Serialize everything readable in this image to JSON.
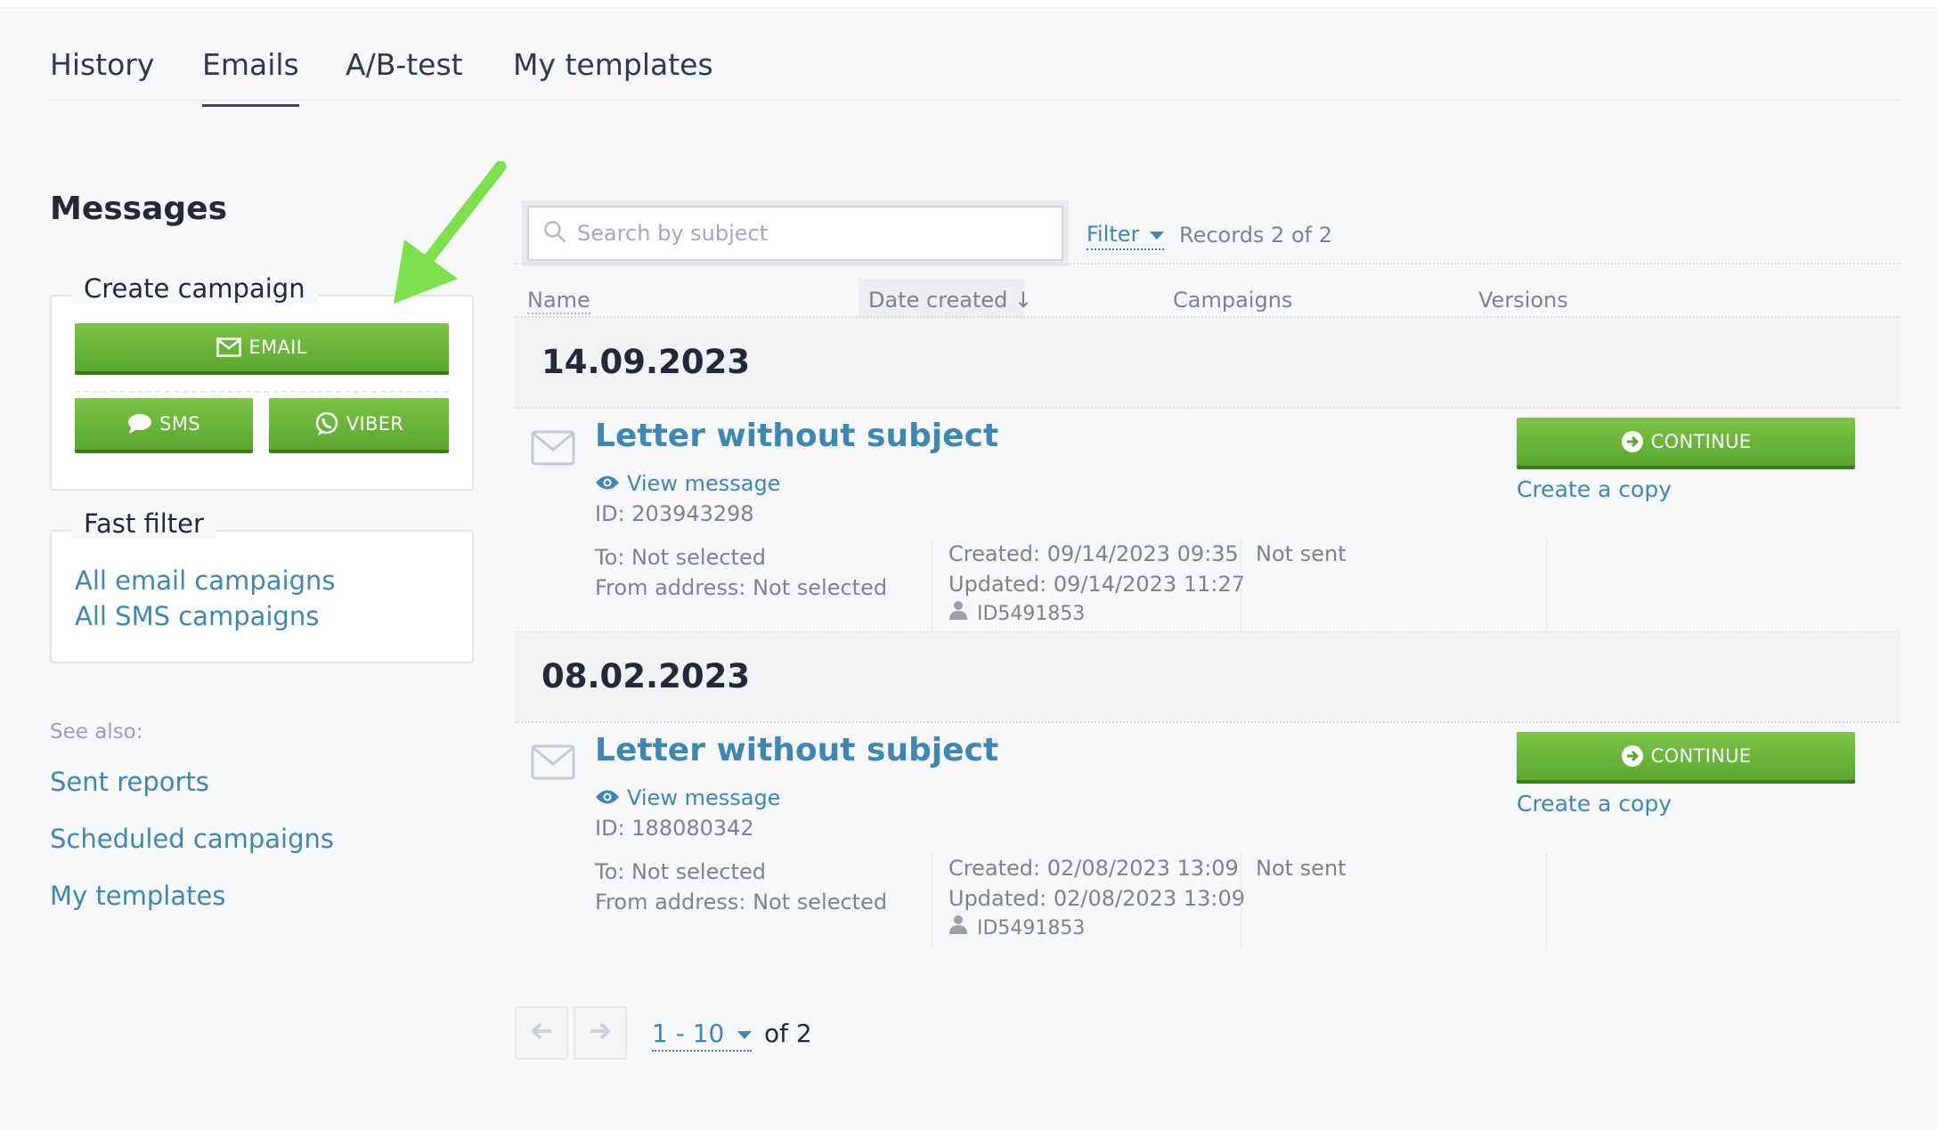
{
  "tabs": [
    {
      "label": "History"
    },
    {
      "label": "Emails"
    },
    {
      "label": "A/B-test"
    },
    {
      "label": "My templates"
    }
  ],
  "sidebar": {
    "title": "Messages",
    "create_campaign": {
      "legend": "Create campaign",
      "email_label": "EMAIL",
      "sms_label": "SMS",
      "viber_label": "VIBER"
    },
    "fast_filter": {
      "legend": "Fast filter",
      "items": [
        {
          "label": "All email campaigns"
        },
        {
          "label": "All SMS campaigns"
        }
      ]
    },
    "see_also": {
      "label": "See also:",
      "links": [
        {
          "label": "Sent reports"
        },
        {
          "label": "Scheduled campaigns"
        },
        {
          "label": "My templates"
        }
      ]
    }
  },
  "toolbar": {
    "search_placeholder": "Search by subject",
    "filter_label": "Filter",
    "records": "Records 2 of 2"
  },
  "columns": [
    {
      "label": "Name"
    },
    {
      "label": "Date created ↓"
    },
    {
      "label": "Campaigns"
    },
    {
      "label": "Versions"
    }
  ],
  "groups": [
    {
      "date": "14.09.2023",
      "message": {
        "title": "Letter without subject",
        "view_label": "View message",
        "id": "ID: 203943298",
        "to": "To: Not selected",
        "from": "From address: Not selected",
        "created": "Created: 09/14/2023 09:35",
        "updated": "Updated: 09/14/2023 11:27",
        "owner": "ID5491853",
        "status": "Not sent",
        "continue_label": "CONTINUE",
        "copy_label": "Create a copy"
      }
    },
    {
      "date": "08.02.2023",
      "message": {
        "title": "Letter without subject",
        "view_label": "View message",
        "id": "ID: 188080342",
        "to": "To: Not selected",
        "from": "From address: Not selected",
        "created": "Created: 02/08/2023 13:09",
        "updated": "Updated: 02/08/2023 13:09",
        "owner": "ID5491853",
        "status": "Not sent",
        "continue_label": "CONTINUE",
        "copy_label": "Create a copy"
      }
    }
  ],
  "pagination": {
    "range": "1 - 10",
    "of": "of 2"
  },
  "colors": {
    "accent_green": "#6bb83a",
    "link_blue": "#3f87b2",
    "annotation_arrow": "#7de04e"
  }
}
